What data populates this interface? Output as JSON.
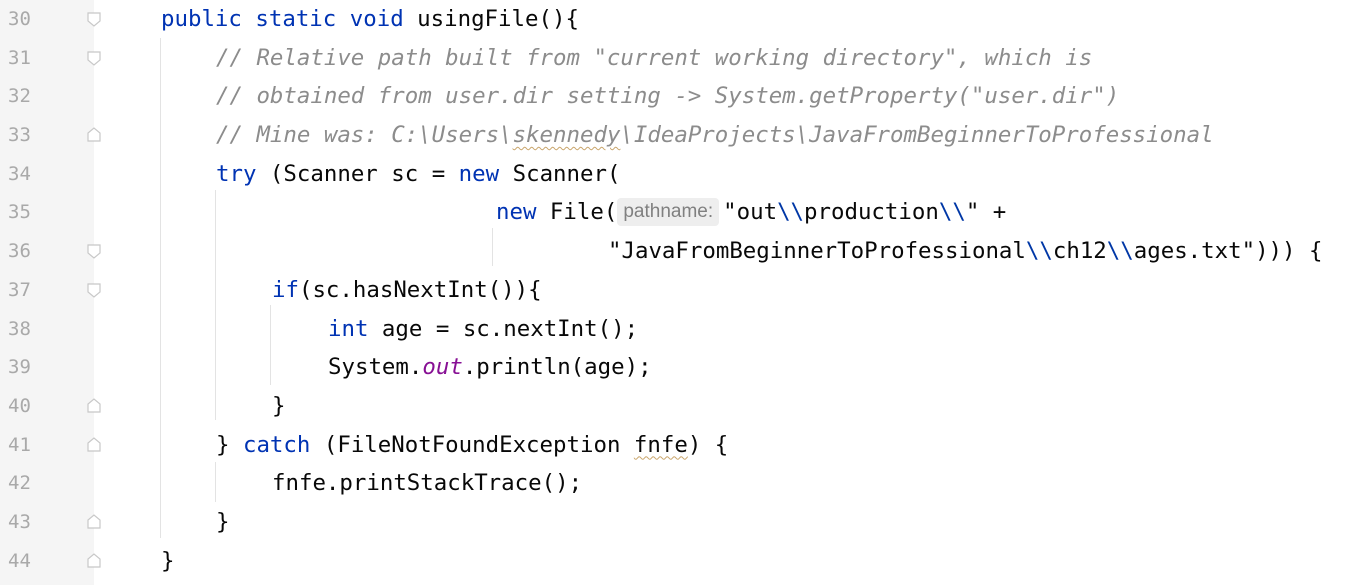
{
  "editor": {
    "line_numbers": [
      "30",
      "31",
      "32",
      "33",
      "34",
      "35",
      "36",
      "37",
      "38",
      "39",
      "40",
      "41",
      "42",
      "43",
      "44"
    ],
    "lines": {
      "l30": {
        "kw_public": "public",
        "kw_static": "static",
        "kw_void": "void",
        "method": "usingFile(){"
      },
      "l31": {
        "comment": "// Relative path built from \"current working directory\", which is"
      },
      "l32": {
        "comment": "// obtained from user.dir setting -> System.getProperty(\"user.dir\")"
      },
      "l33": {
        "comment_a": "// Mine was: C:\\Users\\",
        "comment_b": "skennedy",
        "comment_c": "\\IdeaProjects\\JavaFromBeginnerToProfessional"
      },
      "l34": {
        "kw_try": "try",
        "text_a": " (Scanner sc = ",
        "kw_new": "new",
        "text_b": " Scanner("
      },
      "l35": {
        "kw_new": "new",
        "text_a": " File(",
        "hint": "pathname:",
        "str_a": "\"out",
        "esc_a": "\\\\",
        "str_b": "production",
        "esc_b": "\\\\",
        "str_c": "\"",
        "text_b": " +"
      },
      "l36": {
        "str_a": "\"JavaFromBeginnerToProfessional",
        "esc_a": "\\\\",
        "str_b": "ch12",
        "esc_b": "\\\\",
        "str_c": "ages.txt\"",
        "text_a": "))) {"
      },
      "l37": {
        "kw_if": "if",
        "text_a": "(sc.hasNextInt()){"
      },
      "l38": {
        "kw_int": "int",
        "text_a": " age = sc.nextInt();"
      },
      "l39": {
        "text_a": "System.",
        "field": "out",
        "text_b": ".println(age);"
      },
      "l40": {
        "text_a": "}"
      },
      "l41": {
        "text_a": "} ",
        "kw_catch": "catch",
        "text_b": " (FileNotFoundException ",
        "var": "fnfe",
        "text_c": ") {"
      },
      "l42": {
        "text_a": "fnfe.printStackTrace();"
      },
      "l43": {
        "text_a": "}"
      },
      "l44": {
        "text_a": "}"
      }
    },
    "colors": {
      "keyword": "#0033b3",
      "comment": "#8c8c8c",
      "gutter": "#f5f5f5",
      "line_number": "#a9a9a9"
    }
  }
}
